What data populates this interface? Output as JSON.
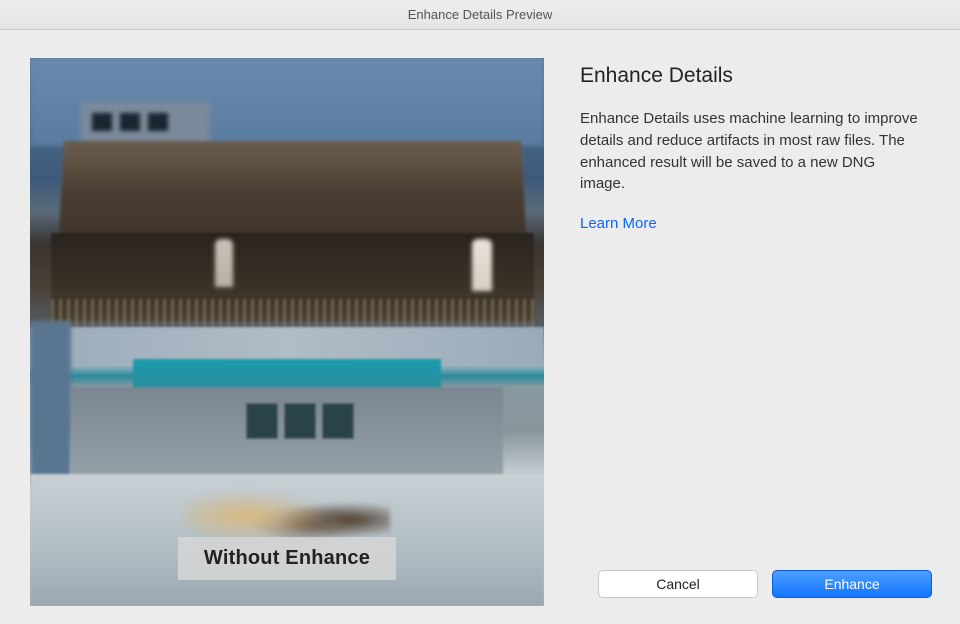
{
  "window": {
    "title": "Enhance Details Preview"
  },
  "preview": {
    "overlay_label": "Without Enhance"
  },
  "panel": {
    "title": "Enhance Details",
    "description": "Enhance Details uses machine learning to improve details and reduce artifacts in most raw files. The enhanced result will be saved to a new DNG image.",
    "learn_more_label": "Learn More"
  },
  "buttons": {
    "cancel": "Cancel",
    "enhance": "Enhance"
  }
}
